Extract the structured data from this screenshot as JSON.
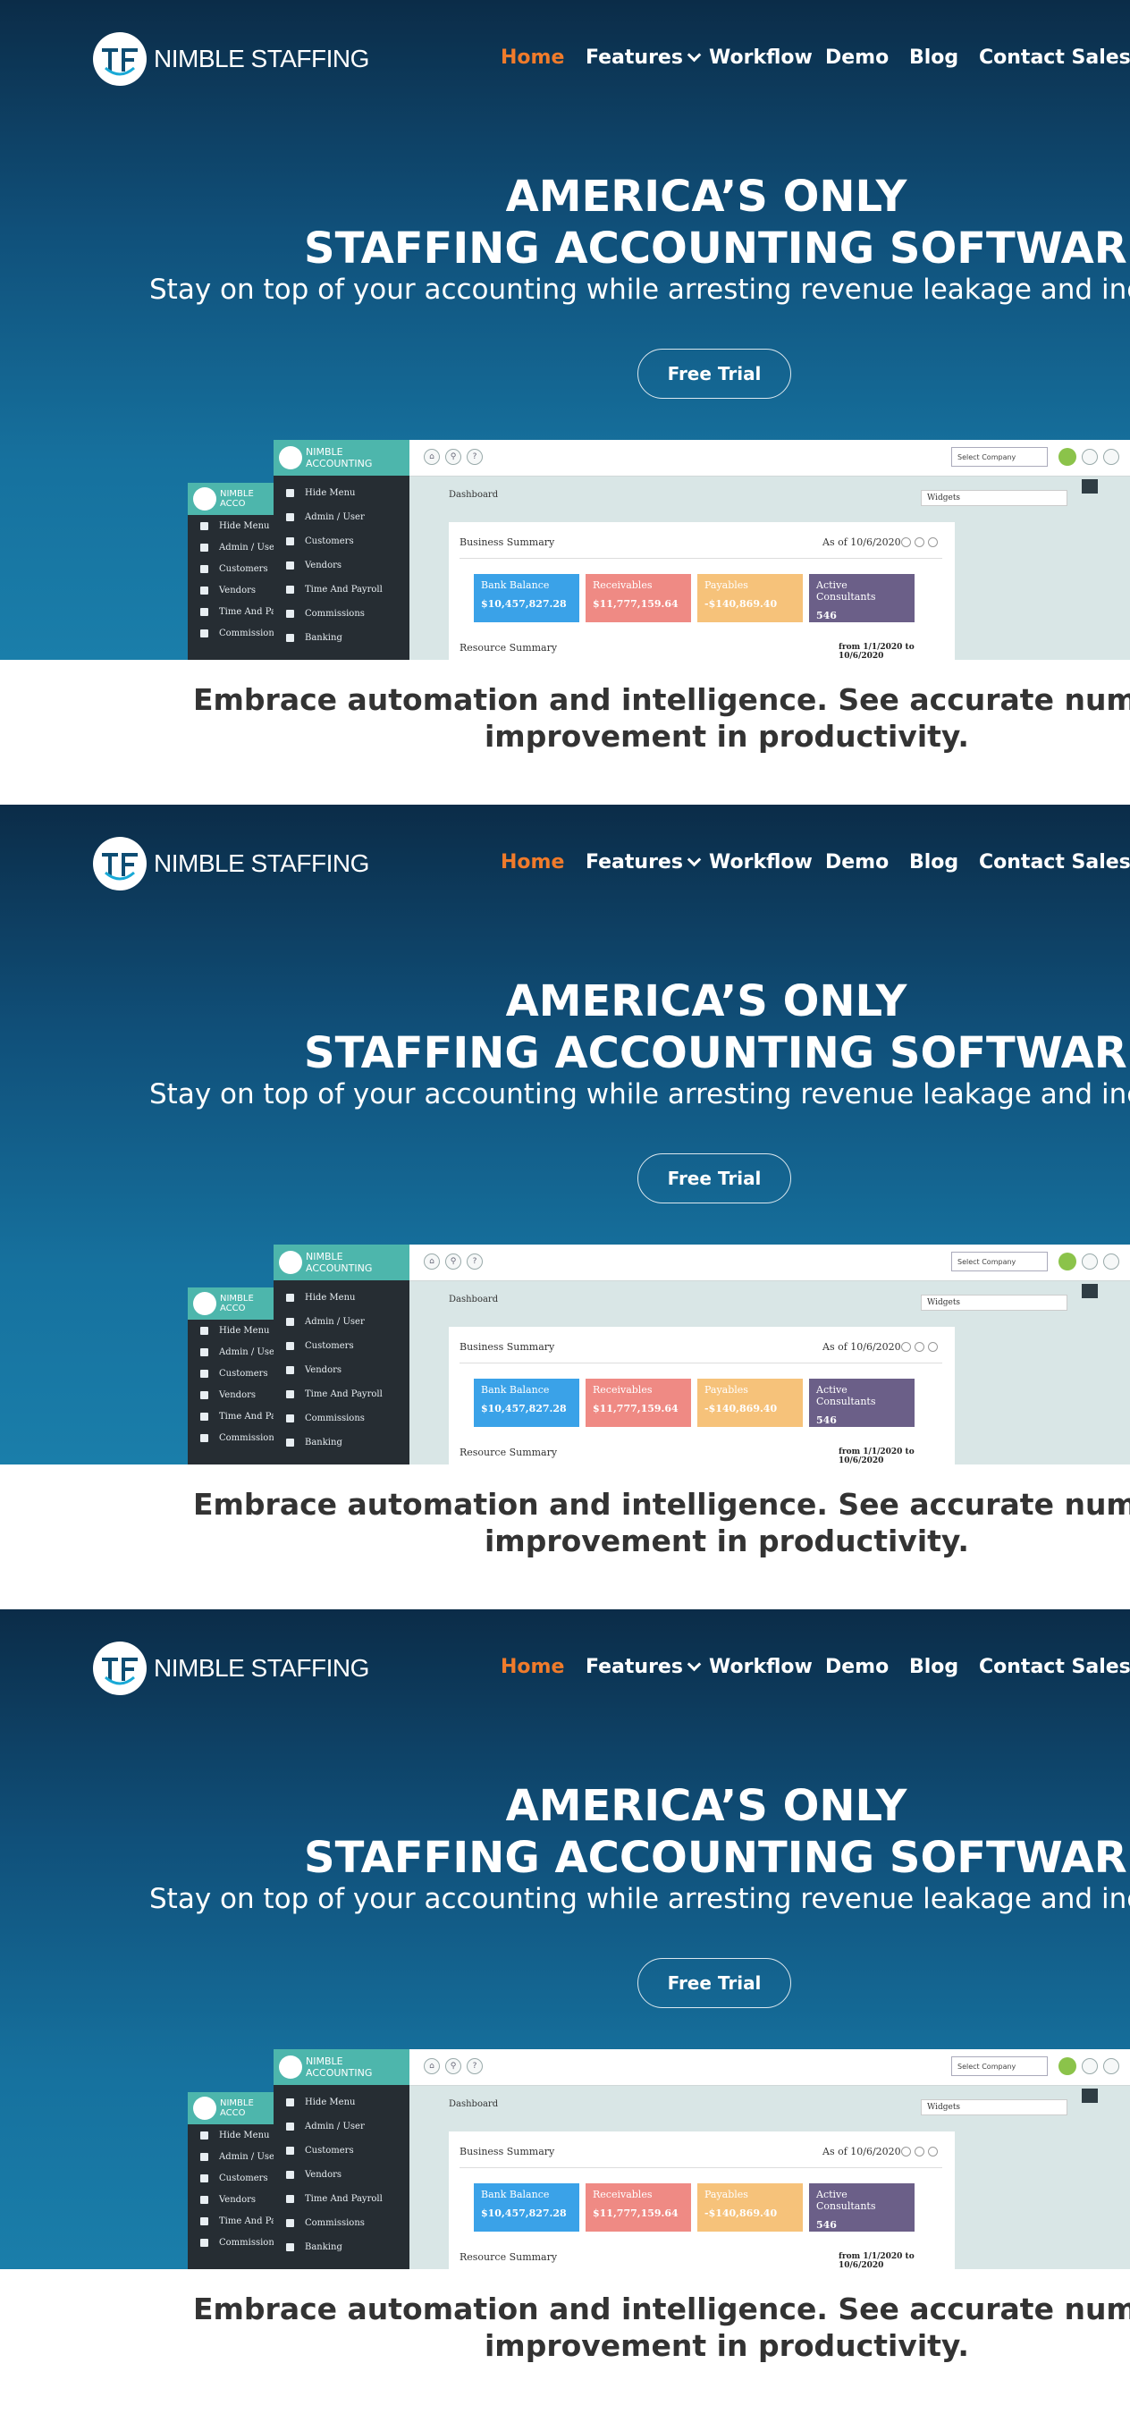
{
  "brand": {
    "name": "NIMBLE STAFFING",
    "logo_mark": "TF"
  },
  "nav": {
    "items": [
      {
        "label": "Home",
        "active": true
      },
      {
        "label": "Features",
        "has_dropdown": true
      },
      {
        "label": "Workflow"
      },
      {
        "label": "Demo"
      },
      {
        "label": "Blog"
      },
      {
        "label": "Contact Sales"
      }
    ]
  },
  "hero": {
    "title_line1": "AMERICA’S ONLY",
    "title_line2": "STAFFING ACCOUNTING SOFTWARE",
    "subtitle": "Stay on top of your accounting while arresting revenue leakage and increasi",
    "cta_label": "Free Trial"
  },
  "app_preview": {
    "brand": "NIMBLE ACCOUNTING",
    "brand_short": "NIMBLE ACCO",
    "sidebar_items": [
      "Hide Menu",
      "Admin / User",
      "Customers",
      "Vendors",
      "Time And Payroll",
      "Commissions",
      "Banking"
    ],
    "back_sidebar_items": [
      "Hide Menu",
      "Admin / User",
      "Customers",
      "Vendors",
      "Time And Payro",
      "Commissions"
    ],
    "select_company": "Select Company",
    "dashboard_label": "Dashboard",
    "widgets_label": "Widgets",
    "business_summary": "Business Summary",
    "as_of": "As of 10/6/2020",
    "tiles": [
      {
        "label": "Bank Balance",
        "value": "$10,457,827.28",
        "color": "#3aa2e8"
      },
      {
        "label": "Receivables",
        "value": "$11,777,159.64",
        "color": "#ef8a84"
      },
      {
        "label": "Payables",
        "value": "-$140,869.40",
        "color": "#f6c27a"
      },
      {
        "label": "Active Consultants",
        "value": "546",
        "color": "#6b5f88"
      }
    ],
    "resource_summary": "Resource Summary",
    "date_range": "from 1/1/2020 to 10/6/2020"
  },
  "tagline": {
    "line1": "Embrace automation and intelligence. See accurate numbers a",
    "line2": "improvement in productivity."
  },
  "colors": {
    "accent": "#f07b2b",
    "hero_top": "#0b2c48",
    "hero_bottom": "#1a7eaa",
    "app_teal": "#4db6ac",
    "sidebar_dark": "#262d33"
  }
}
